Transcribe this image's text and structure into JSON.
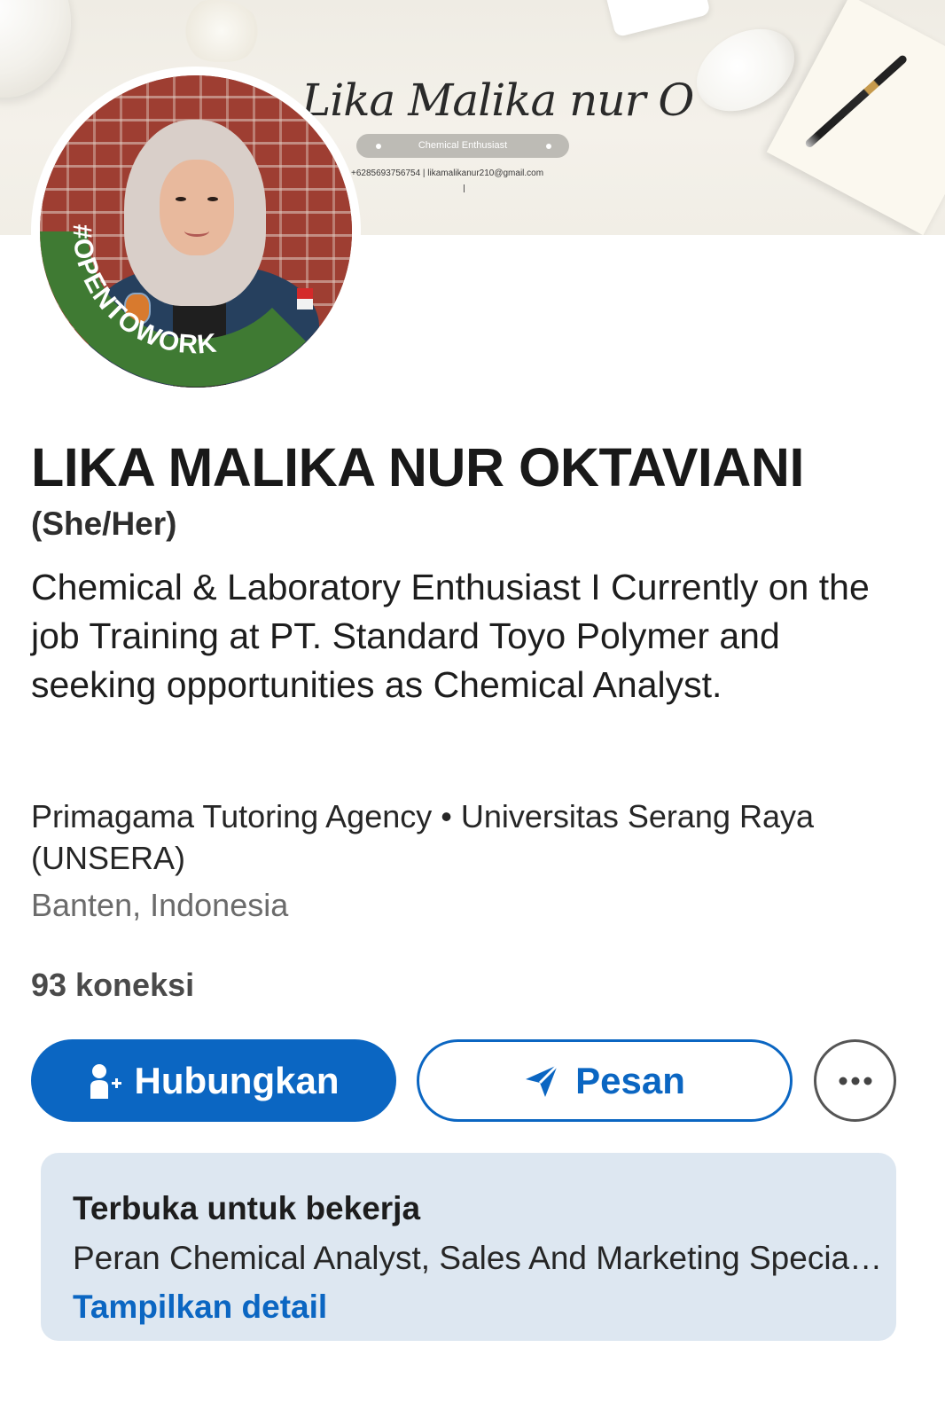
{
  "banner": {
    "name": "Lika Malika nur O",
    "tagline": "Chemical Enthusiast",
    "contact": "+6285693756754  |  likamalikanur210@gmail.com"
  },
  "avatar": {
    "frame_label": "#OPENTOWORK",
    "frame_color": "#3f7a33"
  },
  "profile": {
    "name": "LIKA MALIKA NUR OKTAVIANI",
    "pronouns": "(She/Her)",
    "headline": "Chemical & Laboratory Enthusiast I Currently on the job Training at PT. Standard Toyo Polymer and seeking opportunities as Chemical Analyst.",
    "affiliations": "Primagama Tutoring Agency • Universitas Serang Raya (UNSERA)",
    "location": "Banten, Indonesia",
    "connections": "93 koneksi"
  },
  "actions": {
    "connect_label": "Hubungkan",
    "connect_icon": "add-person-icon",
    "message_label": "Pesan",
    "message_icon": "send-icon",
    "more_icon": "more-icon"
  },
  "open_to_work": {
    "title": "Terbuka untuk bekerja",
    "roles": "Peran Chemical Analyst, Sales And Marketing Specialist",
    "link": "Tampilkan detail"
  },
  "colors": {
    "accent": "#0b66c2",
    "card_bg": "#dde7f1",
    "otw_green": "#3f7a33"
  }
}
